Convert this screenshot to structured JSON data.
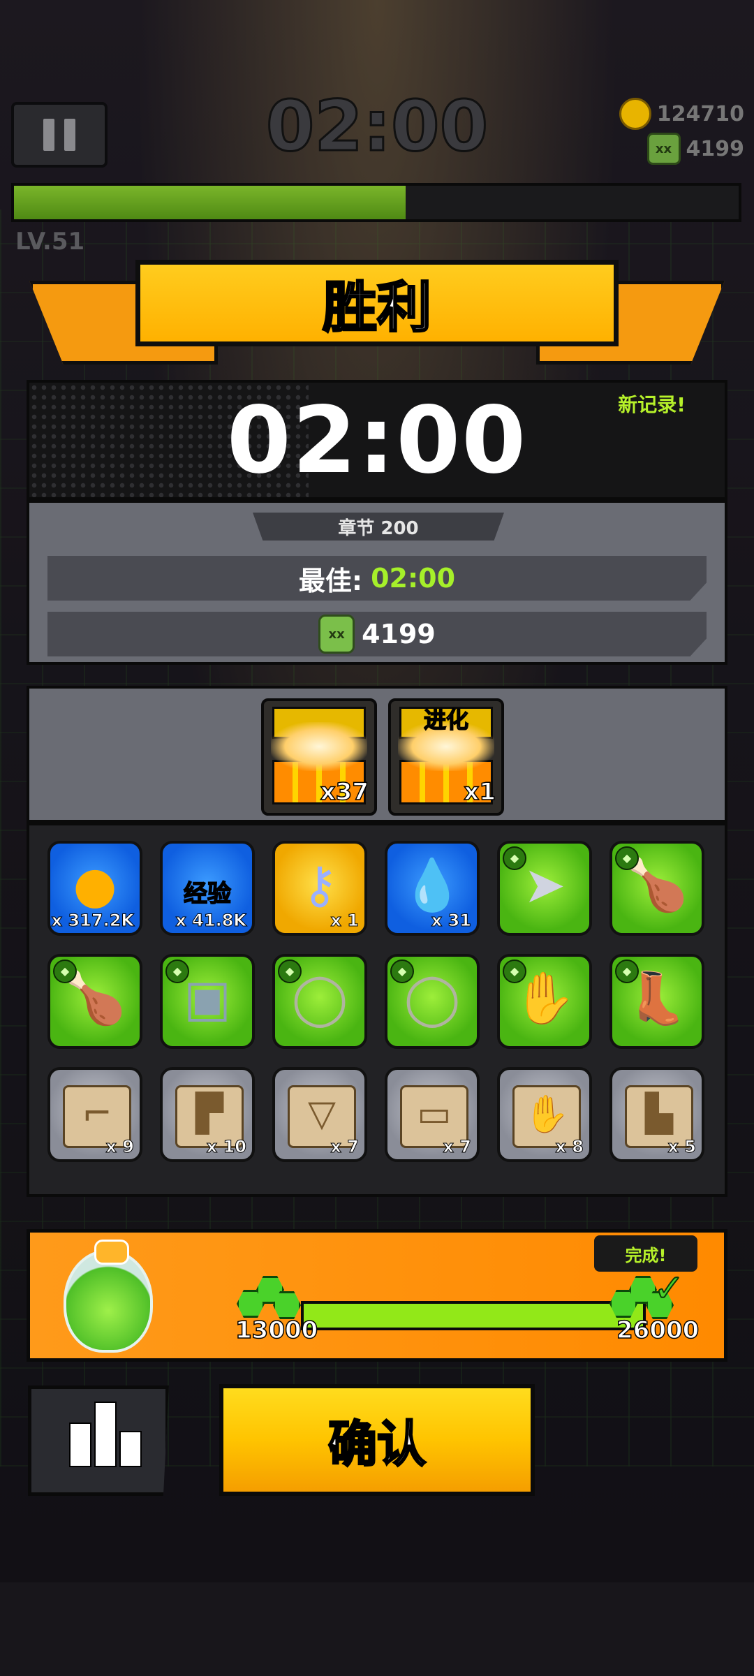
{
  "hud": {
    "timer": "02:00",
    "coins": "124710",
    "kills": "4199",
    "level": "LV.51",
    "xp_progress": 0.54
  },
  "result": {
    "title": "胜利",
    "time": "02:00",
    "new_record": "新记录!",
    "chapter": "章节 200",
    "best_label": "最佳:",
    "best_value": "02:00",
    "kills": "4199"
  },
  "chests": [
    {
      "qty": "x37",
      "tag": ""
    },
    {
      "qty": "x1",
      "tag": "进化"
    }
  ],
  "items": [
    {
      "name": "gold-coin",
      "icon": "coin",
      "color": "blue",
      "qty": "x 317.2K"
    },
    {
      "name": "experience",
      "icon": "exp",
      "color": "blue",
      "qty": "x 41.8K",
      "label": "经验"
    },
    {
      "name": "key",
      "icon": "key",
      "color": "gold",
      "qty": "x 1"
    },
    {
      "name": "essence",
      "icon": "drop",
      "color": "blue",
      "qty": "x 31"
    },
    {
      "name": "kunai",
      "icon": "kunai",
      "color": "green",
      "qty": ""
    },
    {
      "name": "drumstick",
      "icon": "drumstick",
      "color": "green",
      "qty": ""
    },
    {
      "name": "drumstick",
      "icon": "drumstick",
      "color": "green",
      "qty": ""
    },
    {
      "name": "armor",
      "icon": "armor",
      "color": "green",
      "qty": ""
    },
    {
      "name": "necklace",
      "icon": "necklace",
      "color": "green",
      "qty": ""
    },
    {
      "name": "necklace",
      "icon": "necklace",
      "color": "green",
      "qty": ""
    },
    {
      "name": "glove",
      "icon": "glove",
      "color": "green",
      "qty": ""
    },
    {
      "name": "boots",
      "icon": "boots",
      "color": "green",
      "qty": ""
    },
    {
      "name": "weapon-scroll",
      "icon": "scroll-gun",
      "color": "gray",
      "qty": "x 9"
    },
    {
      "name": "armor-scroll",
      "icon": "scroll-shirt",
      "color": "gray",
      "qty": "x 10"
    },
    {
      "name": "necklace-scroll",
      "icon": "scroll-necklace",
      "color": "gray",
      "qty": "x 7"
    },
    {
      "name": "belt-scroll",
      "icon": "scroll-belt",
      "color": "gray",
      "qty": "x 7"
    },
    {
      "name": "glove-scroll",
      "icon": "scroll-glove",
      "color": "gray",
      "qty": "x 8"
    },
    {
      "name": "boots-scroll",
      "icon": "scroll-boots",
      "color": "gray",
      "qty": "x 5"
    }
  ],
  "gem_progress": {
    "start": "13000",
    "end": "26000",
    "status": "完成!",
    "progress": 1.0
  },
  "buttons": {
    "confirm": "确认"
  },
  "colors": {
    "victory_gold": "#ffb100",
    "record_green": "#b6f12a",
    "confirm_yellow": "#ffc400"
  }
}
